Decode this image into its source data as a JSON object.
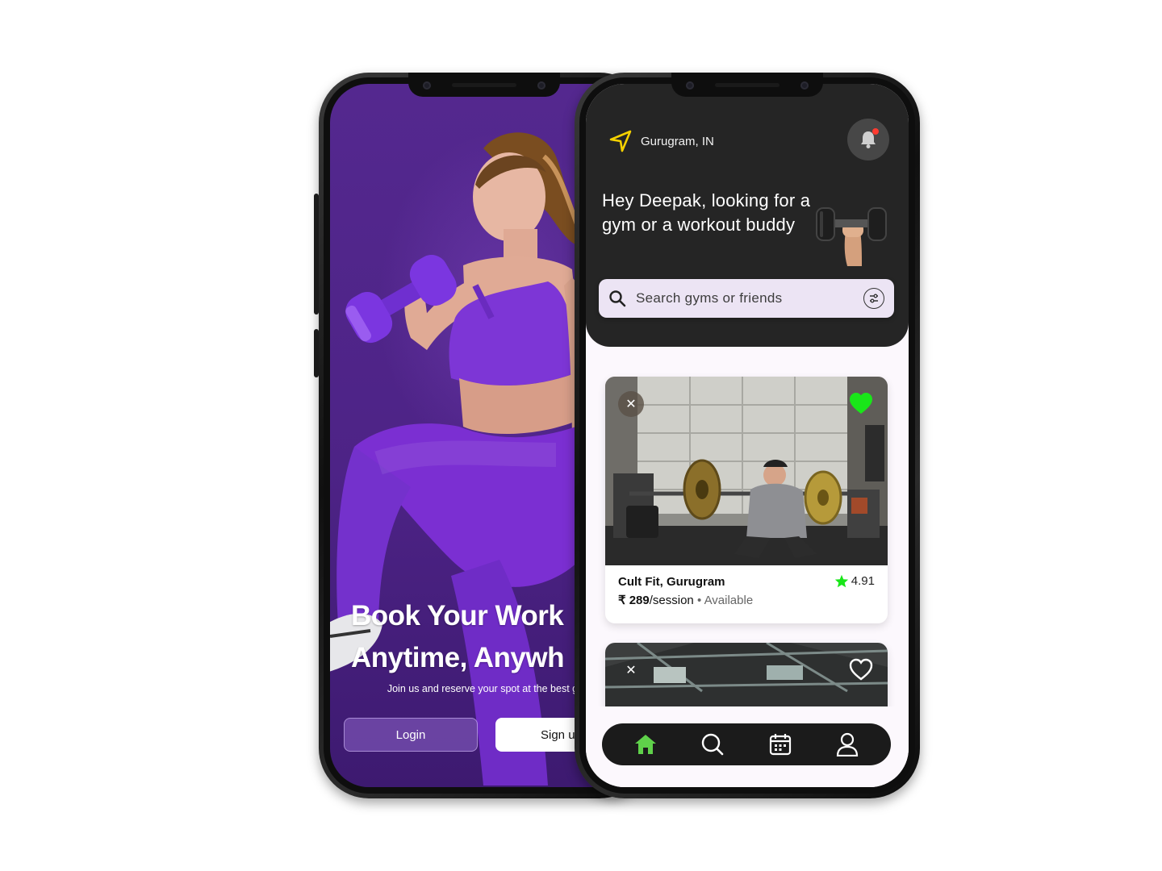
{
  "welcome_screen": {
    "title_line1": "Book Your Work",
    "title_line2": "Anytime, Anywh",
    "subtitle": "Join us and reserve your spot at the best gyr you",
    "login_label": "Login",
    "signup_label": "Sign u"
  },
  "home_screen": {
    "location": "Gurugram, IN",
    "notification_dot_color": "#ff3b30",
    "greeting": "Hey Deepak, looking for a gym or a workout buddy",
    "search": {
      "placeholder": "Search gyms or friends"
    },
    "cards": [
      {
        "name": "Cult Fit, Gurugram",
        "rating": "4.91",
        "currency": "₹",
        "price": "289",
        "price_unit": "/session",
        "separator": "•",
        "status": "Available",
        "favorited": true,
        "close_symbol": "✕"
      },
      {
        "close_symbol": "✕",
        "favorited": false
      }
    ],
    "nav": [
      {
        "name": "home-icon",
        "active": true
      },
      {
        "name": "search-icon",
        "active": false
      },
      {
        "name": "calendar-icon",
        "active": false
      },
      {
        "name": "profile-icon",
        "active": false
      }
    ]
  },
  "colors": {
    "brand_purple": "#54288f",
    "header_dark": "#252525",
    "accent_green": "#19e619",
    "location_yellow": "#f5d100"
  }
}
